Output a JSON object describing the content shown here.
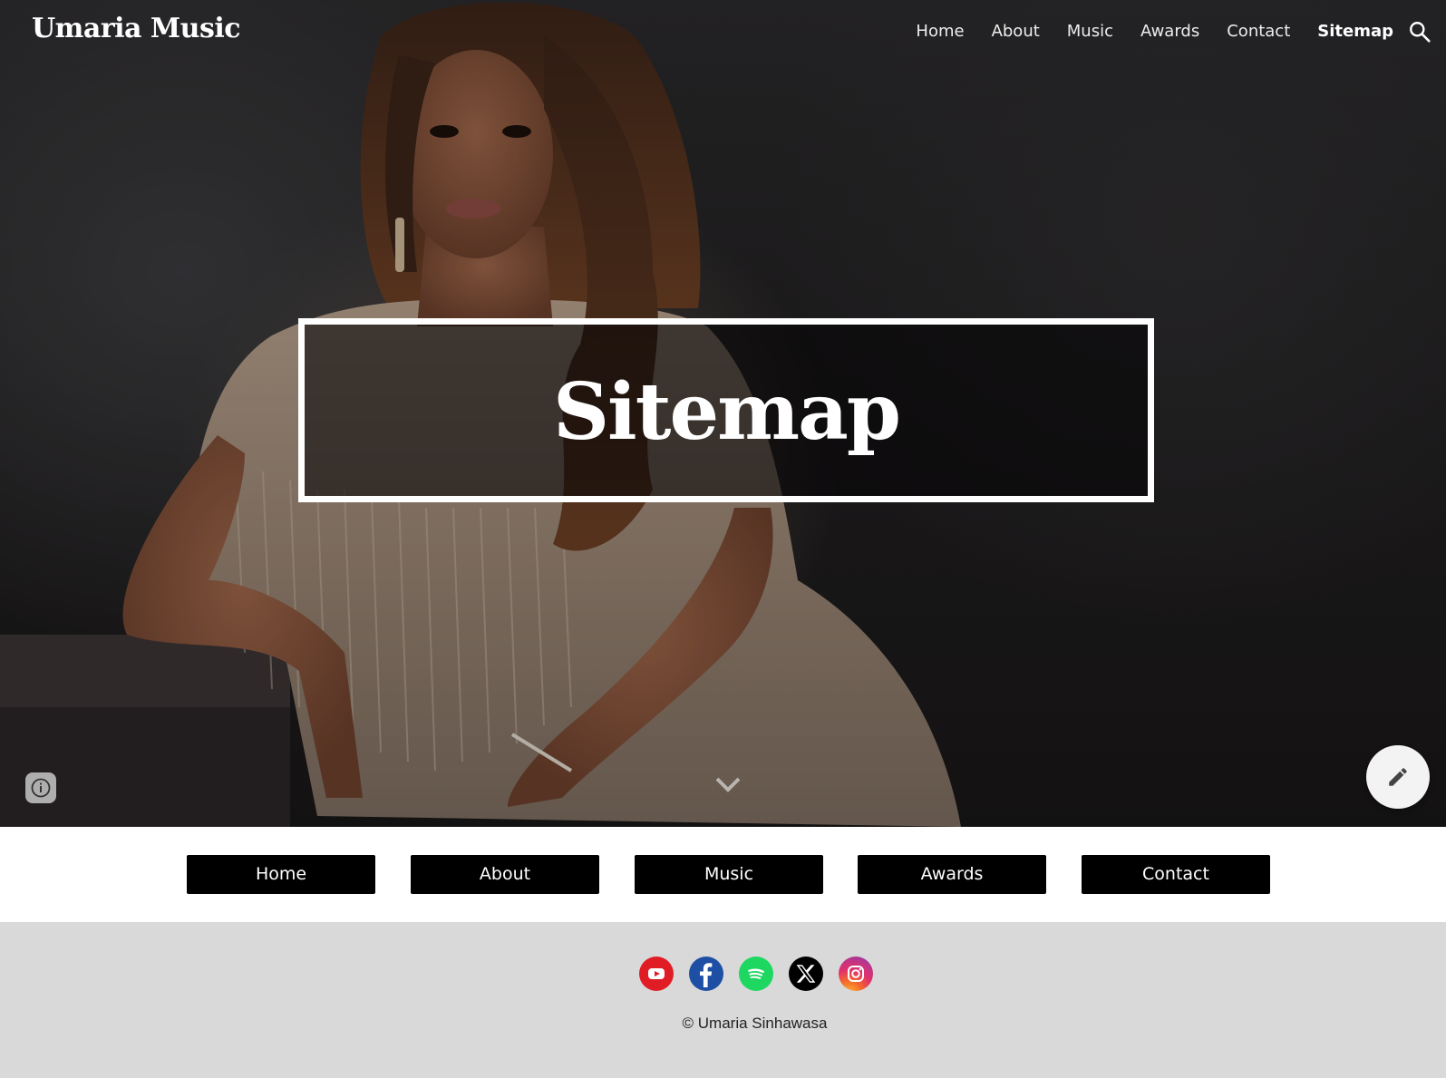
{
  "site": {
    "title": "Umaria Music"
  },
  "nav": {
    "items": [
      {
        "label": "Home",
        "active": false
      },
      {
        "label": "About",
        "active": false
      },
      {
        "label": "Music",
        "active": false
      },
      {
        "label": "Awards",
        "active": false
      },
      {
        "label": "Contact",
        "active": false
      },
      {
        "label": "Sitemap",
        "active": true
      }
    ],
    "search_icon": "search-icon"
  },
  "hero": {
    "title": "Sitemap",
    "image": "portrait of a woman with long wavy hair in a beaded champagne dress against a dark background"
  },
  "controls": {
    "info_icon": "info-icon",
    "scroll_icon": "chevron-down-icon",
    "edit_icon": "pencil-icon"
  },
  "button_row": {
    "buttons": [
      "Home",
      "About",
      "Music",
      "Awards",
      "Contact"
    ]
  },
  "footer": {
    "social": [
      {
        "name": "youtube-icon",
        "color": "#e01d25"
      },
      {
        "name": "facebook-icon",
        "color": "#1d4fa5"
      },
      {
        "name": "spotify-icon",
        "color": "#1ed760"
      },
      {
        "name": "x-icon",
        "color": "#000000"
      },
      {
        "name": "instagram-icon",
        "color": "#e1306c"
      }
    ],
    "copyright": "© Umaria Sinhawasa"
  }
}
